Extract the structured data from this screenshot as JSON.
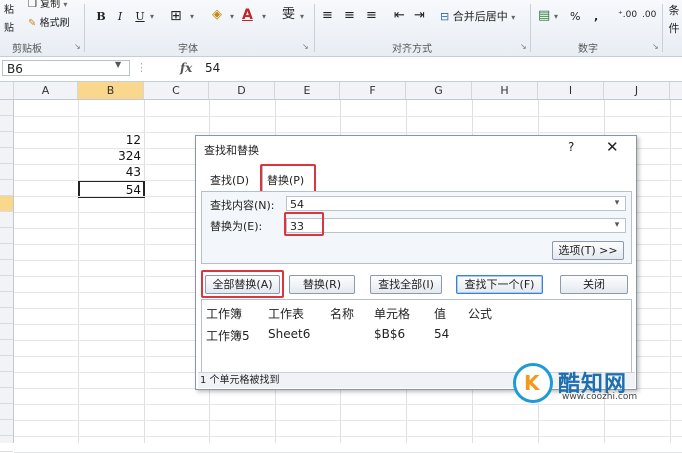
{
  "ribbon": {
    "clipboard": {
      "paste_label": "粘贴",
      "copy_label": "复制",
      "format_painter_label": "格式刷",
      "group_label": "剪贴板"
    },
    "font": {
      "bold_label": "B",
      "italic_label": "I",
      "underline_label": "U",
      "group_label": "字体",
      "font_color_glyph": "A",
      "phonetic_glyph": "雯"
    },
    "alignment": {
      "merge_center_label": "合并后居中",
      "group_label": "对齐方式"
    },
    "number": {
      "percent_label": "%",
      "comma_label": ",",
      "group_label": "数字"
    },
    "styles": {
      "conditional_label": "条件"
    }
  },
  "formula_bar": {
    "name_box": "B6",
    "fx_label": "fx",
    "value": "54"
  },
  "grid": {
    "columns": [
      "A",
      "B",
      "C",
      "D",
      "E",
      "F",
      "G",
      "H",
      "I",
      "J"
    ],
    "selected_column": "B",
    "cells": {
      "b3": "12",
      "b4": "324",
      "b5": "43",
      "b6": "54"
    }
  },
  "dialog": {
    "title": "查找和替换",
    "help_glyph": "?",
    "close_glyph": "✕",
    "tab_find": "查找(D)",
    "tab_replace": "替换(P)",
    "find_label": "查找内容(N):",
    "find_value": "54",
    "replace_label": "替换为(E):",
    "replace_value": "33",
    "options_button": "选项(T) >>",
    "replace_all_button": "全部替换(A)",
    "replace_button": "替换(R)",
    "find_all_button": "查找全部(I)",
    "find_next_button": "查找下一个(F)",
    "close_button": "关闭",
    "results_headers": [
      "工作簿",
      "工作表",
      "名称",
      "单元格",
      "值",
      "公式"
    ],
    "results_row": [
      "工作簿5",
      "Sheet6",
      "",
      "$B$6",
      "54",
      ""
    ],
    "status": "1 个单元格被找到"
  },
  "watermark": {
    "logo_glyph": "K",
    "name": "酷知网",
    "url": "www.coozhi.com"
  },
  "colors": {
    "highlight_red": "#d9363e",
    "selection_orange": "#f9d88e",
    "watermark_blue": "#1d6fb0"
  }
}
